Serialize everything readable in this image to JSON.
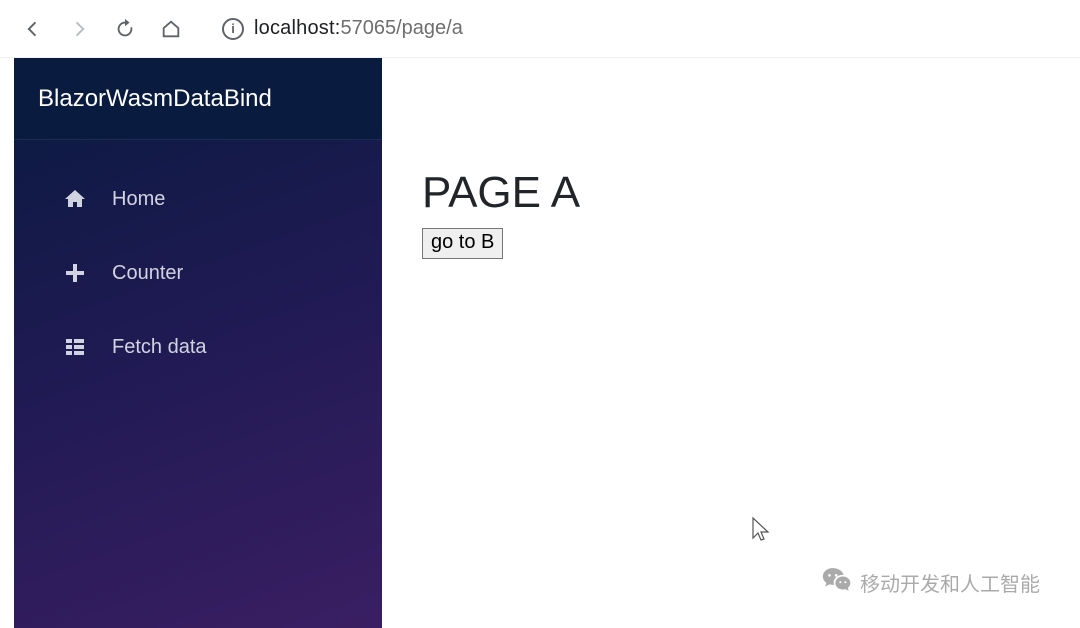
{
  "browser": {
    "host": "localhost:",
    "path": "57065/page/a"
  },
  "sidebar": {
    "brand": "BlazorWasmDataBind",
    "items": [
      {
        "label": "Home"
      },
      {
        "label": "Counter"
      },
      {
        "label": "Fetch data"
      }
    ]
  },
  "main": {
    "title": "PAGE A",
    "button_label": "go to B"
  },
  "watermark": {
    "text": "移动开发和人工智能"
  }
}
